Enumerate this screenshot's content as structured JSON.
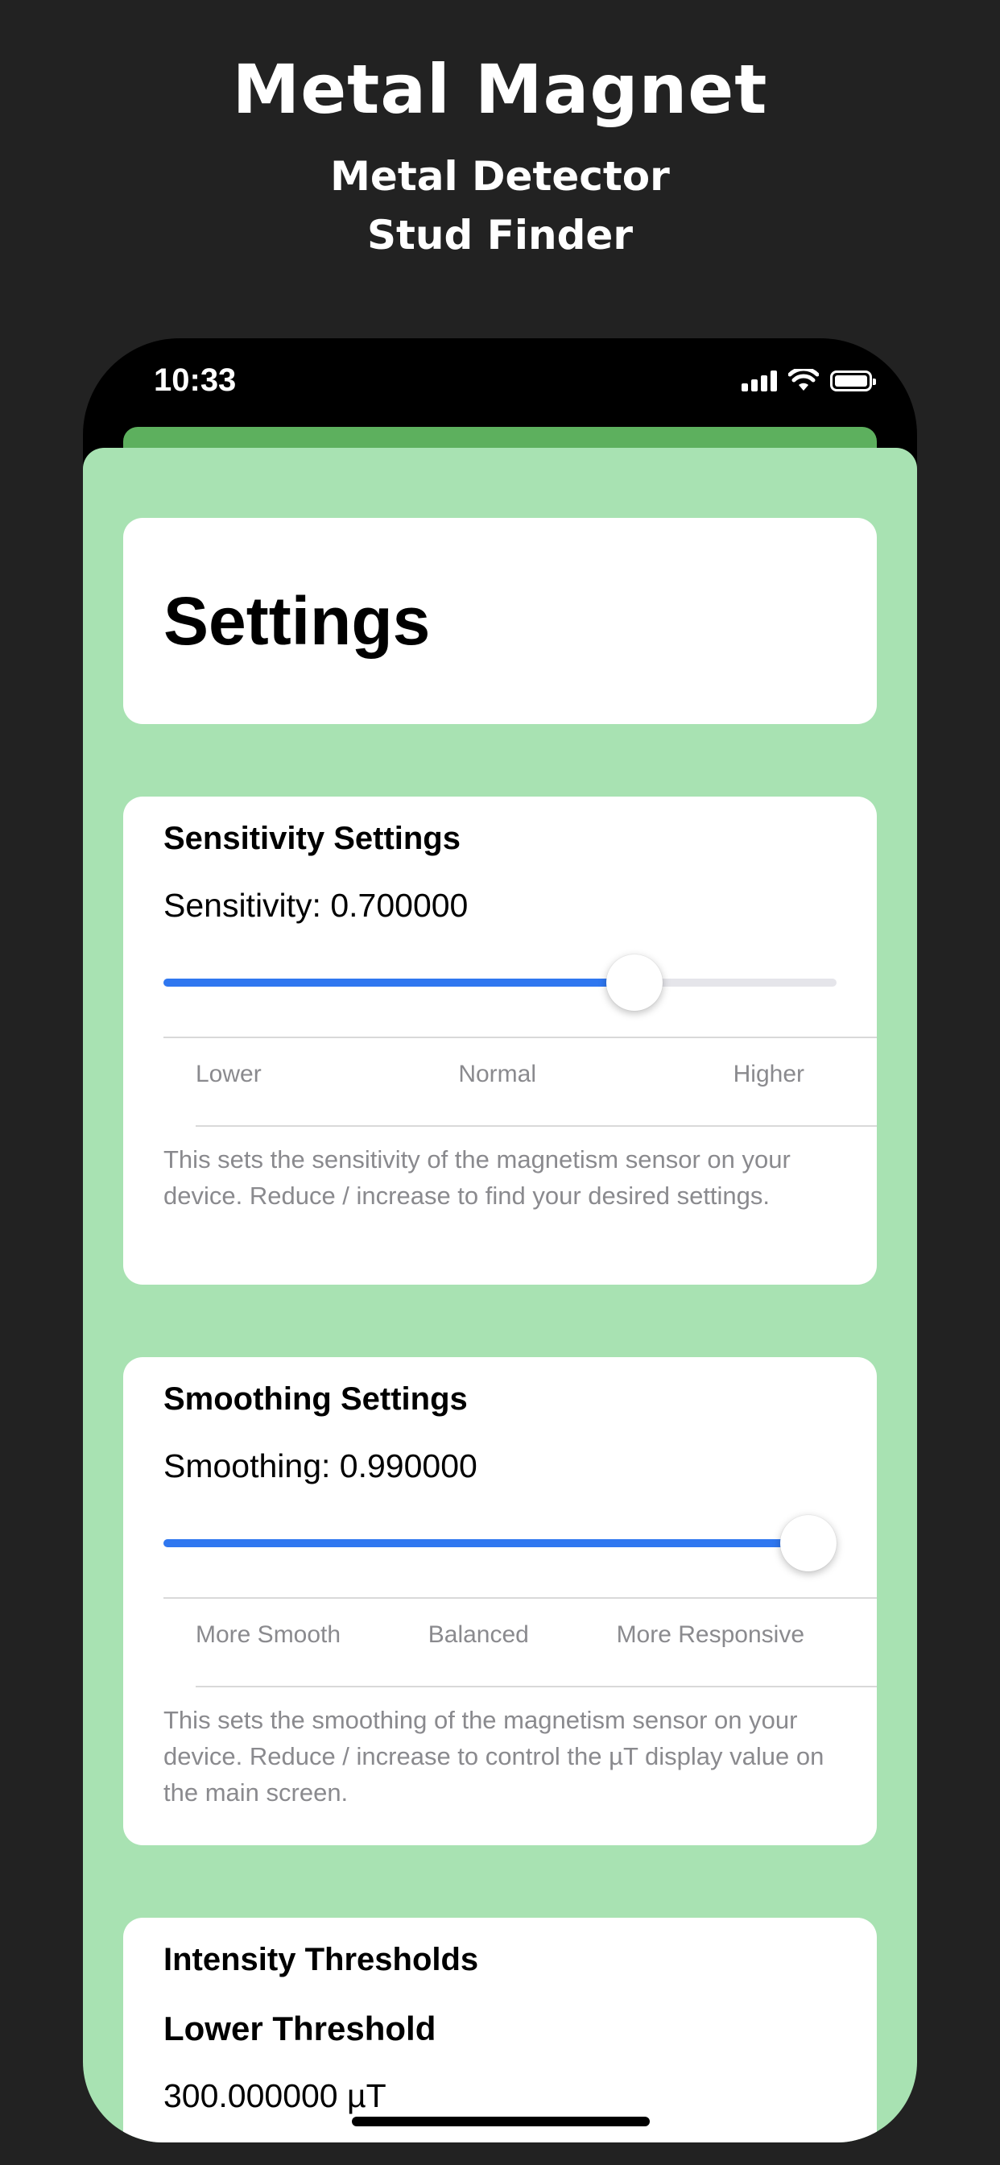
{
  "promo": {
    "title": "Metal Magnet",
    "subtitle_line1": "Metal Detector",
    "subtitle_line2": "Stud Finder"
  },
  "status_bar": {
    "time": "10:33",
    "icons": [
      "cellular-signal-icon",
      "wifi-icon",
      "battery-icon"
    ]
  },
  "colors": {
    "background": "#222222",
    "sheet": "#a8e2b2",
    "header_strip": "#5db05e",
    "slider_fill": "#2f77f0"
  },
  "page": {
    "title": "Settings"
  },
  "sensitivity": {
    "section_title": "Sensitivity Settings",
    "value_label": "Sensitivity: 0.700000",
    "slider_value": 0.7,
    "segments": [
      "Lower",
      "Normal",
      "Higher"
    ],
    "description": "This sets the sensitivity of the magnetism sensor on your device. Reduce / increase to find your desired settings."
  },
  "smoothing": {
    "section_title": "Smoothing Settings",
    "value_label": "Smoothing: 0.990000",
    "slider_value": 0.99,
    "segments": [
      "More Smooth",
      "Balanced",
      "More Responsive"
    ],
    "description": "This sets the smoothing of the magnetism sensor on your device. Reduce / increase to control the µT display value on the main screen."
  },
  "thresholds": {
    "section_title": "Intensity Thresholds",
    "lower_heading": "Lower Threshold",
    "lower_value": "300.000000 µT"
  }
}
